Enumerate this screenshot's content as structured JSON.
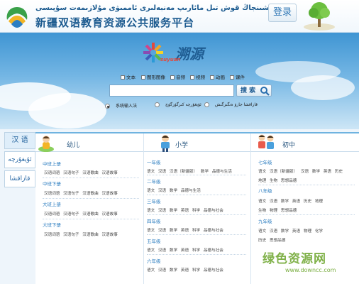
{
  "header": {
    "title_uyghur": "شىنجاڭ قوش تىل مائارىپ مەنبەلىرى ئاممىۋى مۇلازىمەت سۇپىسى",
    "title_chinese": "新疆双语教育资源公共服务平台",
    "login_label": "登录"
  },
  "hero": {
    "logo_text": "溯源",
    "logo_sub": "suyuan",
    "filters": [
      "文本",
      "图形图像",
      "音频",
      "视频",
      "动画",
      "课件"
    ],
    "search": {
      "value": "",
      "button_label": "搜 索"
    },
    "input_methods": [
      {
        "label": "系统输入法",
        "selected": true
      },
      {
        "label": "ئۇيغۇرچە كىرگۈزگۈچ",
        "selected": false
      },
      {
        "label": "قازاقشا جازۋ ەنگىزگىش",
        "selected": false
      }
    ]
  },
  "left_tabs": [
    "汉 语",
    "ئۇيغۇرچە",
    "قازاقشا"
  ],
  "columns": {
    "kindergarten": {
      "title": "幼儿",
      "groups": [
        {
          "name": "中班上册",
          "items": "汉语词语  汉语句子  汉语歌曲  汉语故事"
        },
        {
          "name": "中班下册",
          "items": "汉语词语  汉语句子  汉语歌曲  汉语故事"
        },
        {
          "name": "大班上册",
          "items": "汉语词语  汉语句子  汉语歌曲  汉语故事"
        },
        {
          "name": "大班下册",
          "items": "汉语词语  汉语句子  汉语歌曲  汉语故事"
        }
      ]
    },
    "primary": {
      "title": "小学",
      "groups": [
        {
          "name": "一年级",
          "items": "语文  汉语  汉语（新疆版）  数学  品德与生活"
        },
        {
          "name": "二年级",
          "items": "语文  汉语  数学  品德与生活"
        },
        {
          "name": "三年级",
          "items": "语文  汉语  数学  英语  科学  品德与社会"
        },
        {
          "name": "四年级",
          "items": "语文  汉语  数学  英语  科学  品德与社会"
        },
        {
          "name": "五年级",
          "items": "语文  汉语  数学  英语  科学  品德与社会"
        },
        {
          "name": "六年级",
          "items": "语文  汉语  数学  英语  科学  品德与社会"
        }
      ]
    },
    "middle": {
      "title": "初中",
      "groups": [
        {
          "name": "七年级",
          "items": "语文  汉语（新疆版）  汉语  数学  英语  历史",
          "items2": "地理  生物  思想品德"
        },
        {
          "name": "八年级",
          "items": "语文  汉语  数学  英语  历史  地理",
          "items2": "生物  物理  思想品德"
        },
        {
          "name": "九年级",
          "items": "语文  汉语  数学  英语  物理  化学",
          "items2": "历史  思想品德"
        }
      ]
    }
  },
  "watermark": {
    "text": "绿色资源网",
    "url": "www.downcc.com"
  }
}
